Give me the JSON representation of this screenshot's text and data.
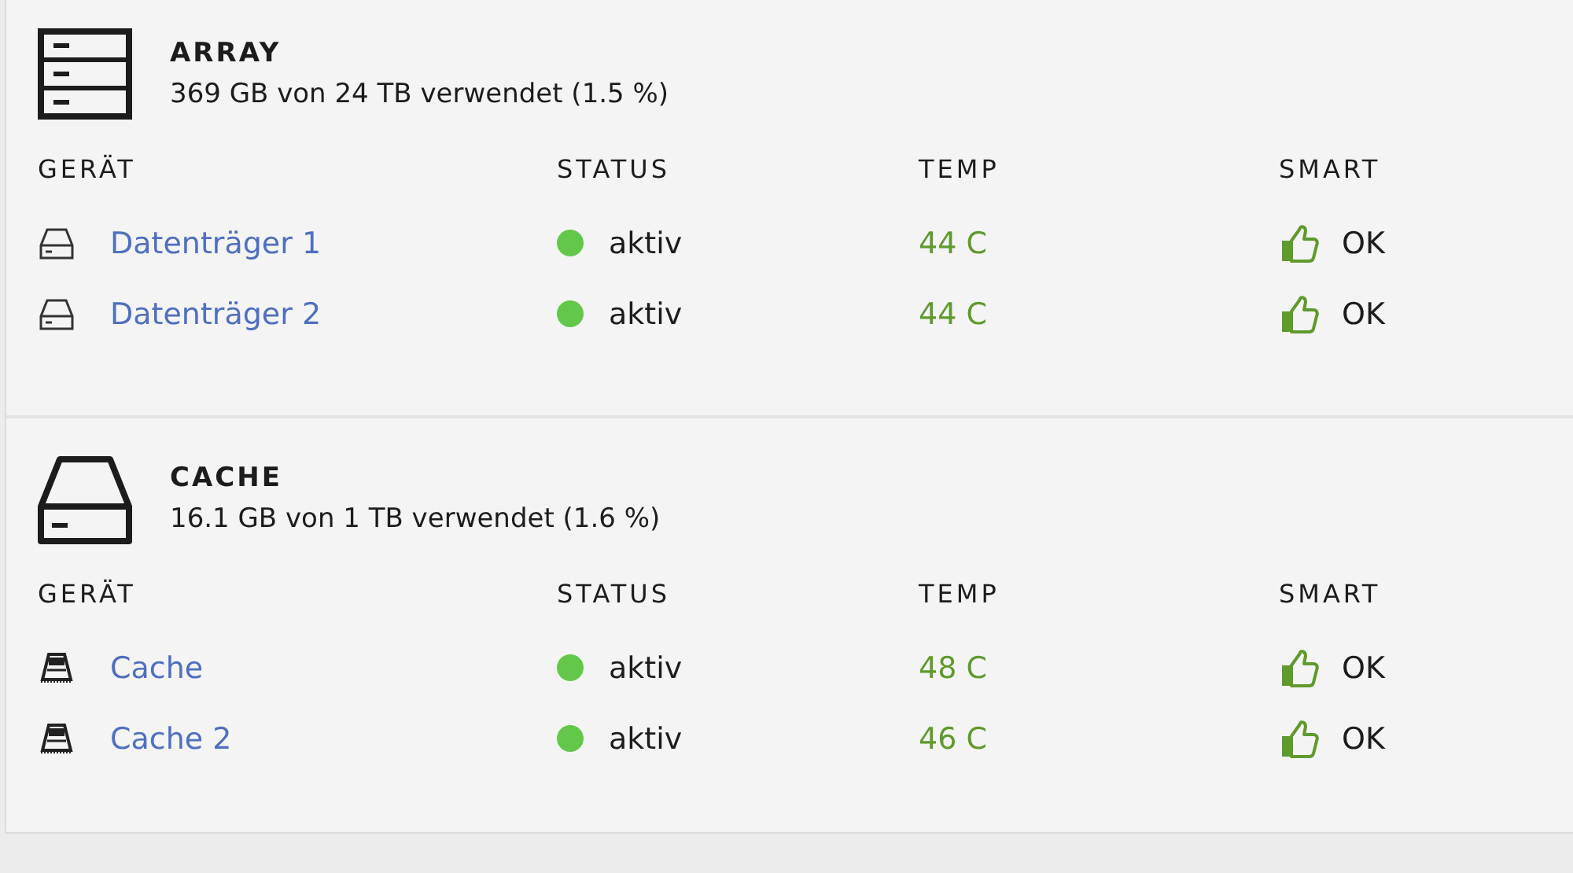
{
  "sections": [
    {
      "kind": "array",
      "title": "ARRAY",
      "usage": "369 GB von 24 TB verwendet (1.5 %)",
      "columns": [
        "GERÄT",
        "STATUS",
        "TEMP",
        "SMART"
      ],
      "devices": [
        {
          "kind": "hdd",
          "name": "Datenträger 1",
          "status": "aktiv",
          "color": "#63c84a",
          "temp": "44 C",
          "smart": "OK"
        },
        {
          "kind": "hdd",
          "name": "Datenträger 2",
          "status": "aktiv",
          "color": "#63c84a",
          "temp": "44 C",
          "smart": "OK"
        }
      ]
    },
    {
      "kind": "cache",
      "title": "CACHE",
      "usage": "16.1 GB von 1 TB verwendet (1.6 %)",
      "columns": [
        "GERÄT",
        "STATUS",
        "TEMP",
        "SMART"
      ],
      "devices": [
        {
          "kind": "ssd",
          "name": "Cache",
          "status": "aktiv",
          "color": "#63c84a",
          "temp": "48 C",
          "smart": "OK"
        },
        {
          "kind": "ssd",
          "name": "Cache 2",
          "status": "aktiv",
          "color": "#63c84a",
          "temp": "46 C",
          "smart": "OK"
        }
      ]
    }
  ]
}
